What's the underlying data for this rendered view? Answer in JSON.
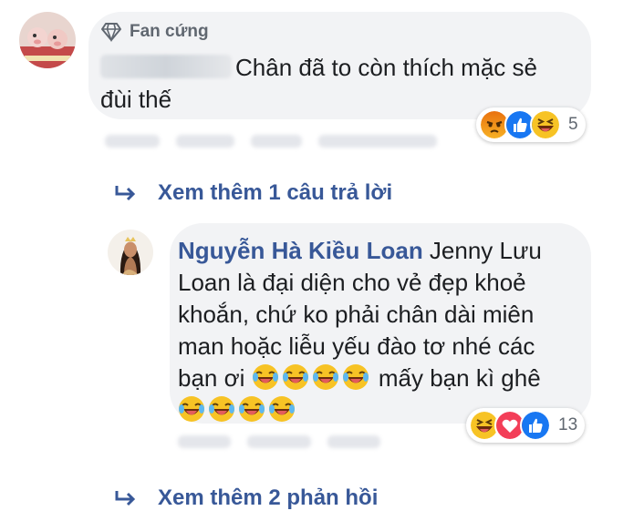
{
  "comment1": {
    "badge_label": "Fan cứng",
    "badge_icon": "diamond-icon",
    "text": "Chân đã to còn thích mặc sẻ đùi thế",
    "reactions": [
      "angry",
      "like",
      "haha"
    ],
    "reaction_count": "5"
  },
  "more1": {
    "label": "Xem thêm 1 câu trả lời",
    "icon": "reply-arrow-icon"
  },
  "comment2": {
    "author": "Nguyễn Hà Kiều Loan",
    "text_before": " Jenny Lưu Loan là đại diện cho vẻ đẹp khoẻ khoắn, chứ ko phải chân dài miên man hoặc liễu yếu đào tơ nhé các bạn ơi ",
    "text_middle": " mấy bạn kì ghê ",
    "reactions": [
      "haha",
      "love",
      "like"
    ],
    "reaction_count": "13"
  },
  "more2": {
    "label": "Xem thêm 2 phản hồi",
    "icon": "reply-arrow-icon"
  },
  "colors": {
    "link": "#385898",
    "bubble": "#f2f3f5",
    "like": "#1877f2",
    "love": "#f33e58",
    "emoji": "#f7b125"
  }
}
